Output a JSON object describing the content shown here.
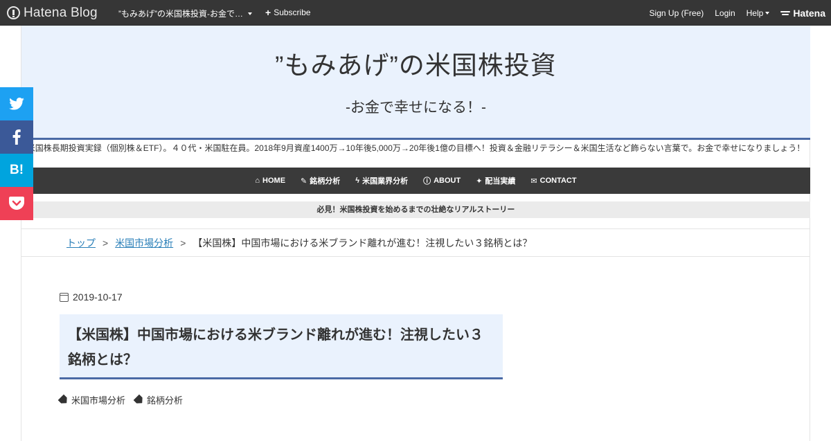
{
  "topbar": {
    "logo": "Hatena Blog",
    "blog_name": "”もみあげ”の米国株投資-お金で…",
    "subscribe": "Subscribe",
    "signup": "Sign Up (Free)",
    "login": "Login",
    "help": "Help",
    "hatena": "Hatena"
  },
  "header": {
    "title": "”もみあげ”の米国株投資",
    "subtitle": "-お金で幸せになる！-"
  },
  "description": "米国株長期投資実録（個別株＆ETF）。４０代・米国駐在員。2018年9月資産1400万→10年後5,000万→20年後1億の目標へ！投資＆金融リテラシー＆米国生活など飾らない言葉で。お金で幸せになりましょう！",
  "nav": {
    "items": [
      {
        "icon": "⌂",
        "label": "HOME"
      },
      {
        "icon": "✎",
        "label": "銘柄分析"
      },
      {
        "icon": "ϟ",
        "label": "米国業界分析"
      },
      {
        "icon": "ⓘ",
        "label": "ABOUT"
      },
      {
        "icon": "✦",
        "label": "配当実績"
      },
      {
        "icon": "✉",
        "label": "CONTACT"
      }
    ]
  },
  "notice": "必見！米国株投資を始めるまでの壮絶なリアルストーリー",
  "breadcrumb": {
    "top": "トップ",
    "category": "米国市場分析",
    "current": "【米国株】中国市場における米ブランド離れが進む！注視したい３銘柄とは？",
    "sep": ">"
  },
  "article": {
    "date": "2019-10-17",
    "title": "【米国株】中国市場における米ブランド離れが進む！注視したい３銘柄とは？",
    "tags": [
      "米国市場分析",
      "銘柄分析"
    ]
  },
  "share": {
    "hatebu": "B!"
  },
  "colors": {
    "topbar": "#363636",
    "header_bg": "#eaf2fd",
    "accent": "#4a6aa5",
    "twitter": "#1da1f2",
    "facebook": "#3b5998",
    "hatebu": "#00a4de",
    "pocket": "#ef4056"
  }
}
